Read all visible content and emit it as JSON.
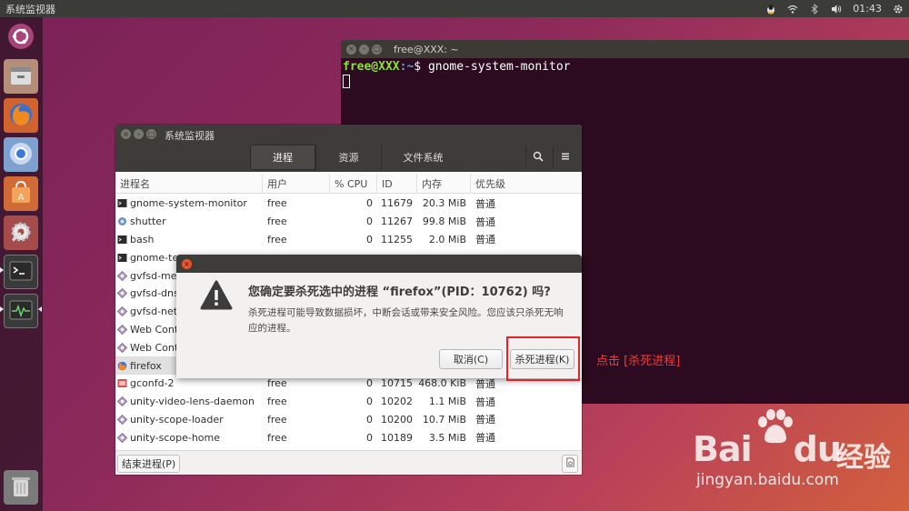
{
  "top_panel": {
    "app_title": "系统监视器",
    "clock": "01:43"
  },
  "terminal": {
    "title": "free@XXX: ~",
    "prompt_user": "free@XXX",
    "prompt_path": ":~",
    "prompt_symbol": "$",
    "command": "gnome-system-monitor"
  },
  "sysmon": {
    "title": "系统监视器",
    "tabs": [
      "进程",
      "资源",
      "文件系统"
    ],
    "columns": [
      "进程名",
      "用户",
      "% CPU",
      "ID",
      "内存",
      "优先级"
    ],
    "rows": [
      {
        "name": "gnome-system-monitor",
        "user": "free",
        "cpu": "0",
        "id": "11679",
        "mem": "20.3 MiB",
        "pri": "普通",
        "icon": "terminal-app-icon"
      },
      {
        "name": "shutter",
        "user": "free",
        "cpu": "0",
        "id": "11267",
        "mem": "99.8 MiB",
        "pri": "普通",
        "icon": "shutter-icon"
      },
      {
        "name": "bash",
        "user": "free",
        "cpu": "0",
        "id": "11255",
        "mem": "2.0 MiB",
        "pri": "普通",
        "icon": "terminal-app-icon"
      },
      {
        "name": "gnome-ter",
        "user": "",
        "cpu": "",
        "id": "",
        "mem": "",
        "pri": "",
        "icon": "terminal-app-icon"
      },
      {
        "name": "gvfsd-meta",
        "user": "",
        "cpu": "",
        "id": "",
        "mem": "",
        "pri": "",
        "icon": "gear-diamond-icon"
      },
      {
        "name": "gvfsd-dnss",
        "user": "",
        "cpu": "",
        "id": "",
        "mem": "",
        "pri": "",
        "icon": "gear-diamond-icon"
      },
      {
        "name": "gvfsd-netw",
        "user": "",
        "cpu": "",
        "id": "",
        "mem": "",
        "pri": "",
        "icon": "gear-diamond-icon"
      },
      {
        "name": "Web Conte",
        "user": "",
        "cpu": "",
        "id": "",
        "mem": "",
        "pri": "",
        "icon": "gear-diamond-icon"
      },
      {
        "name": "Web Conte",
        "user": "",
        "cpu": "",
        "id": "",
        "mem": "",
        "pri": "",
        "icon": "gear-diamond-icon"
      },
      {
        "name": "firefox",
        "user": "",
        "cpu": "",
        "id": "",
        "mem": "",
        "pri": "",
        "icon": "firefox-small-icon"
      },
      {
        "name": "gconfd-2",
        "user": "free",
        "cpu": "0",
        "id": "10715",
        "mem": "468.0 KiB",
        "pri": "普通",
        "icon": "gconf-icon"
      },
      {
        "name": "unity-video-lens-daemon",
        "user": "free",
        "cpu": "0",
        "id": "10202",
        "mem": "1.1 MiB",
        "pri": "普通",
        "icon": "gear-diamond-icon"
      },
      {
        "name": "unity-scope-loader",
        "user": "free",
        "cpu": "0",
        "id": "10200",
        "mem": "10.7 MiB",
        "pri": "普通",
        "icon": "gear-diamond-icon"
      },
      {
        "name": "unity-scope-home",
        "user": "free",
        "cpu": "0",
        "id": "10189",
        "mem": "3.5 MiB",
        "pri": "普通",
        "icon": "gear-diamond-icon"
      }
    ],
    "end_process_label": "结束进程(P)"
  },
  "dialog": {
    "heading": "您确定要杀死选中的进程 “firefox”(PID：10762) 吗?",
    "body": "杀死进程可能导致数据损坏，中断会话或带来安全风险。您应该只杀死无响应的进程。",
    "cancel_label": "取消(C)",
    "kill_label": "杀死进程(K)"
  },
  "annotation": {
    "text": "点击 [杀死进程]",
    "color": "#f03c3c"
  },
  "watermark": {
    "brand_latin": "Bai",
    "brand_latin2": "du",
    "brand_cn": "经验",
    "url": "jingyan.baidu.com"
  },
  "colors": {
    "terminal_bg": "#2c0a1f",
    "prompt_user": "#8ae234",
    "prompt_path": "#729fcf",
    "titlebar": "#3d3c39",
    "close_button": "#e5562d",
    "highlight": "#e8202a"
  }
}
